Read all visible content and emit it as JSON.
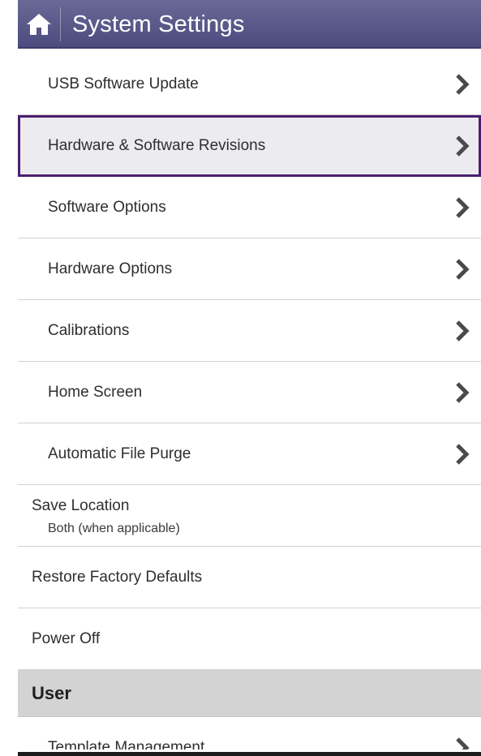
{
  "header": {
    "title": "System Settings",
    "home_icon": "home-icon",
    "bar_color": "#55558a"
  },
  "menu": {
    "items": [
      {
        "label": "USB Software Update",
        "chevron": "chevron-right-icon"
      },
      {
        "label": "Hardware & Software Revisions",
        "chevron": "chevron-right-icon",
        "selected": true
      },
      {
        "label": "Software Options",
        "chevron": "chevron-right-icon"
      },
      {
        "label": "Hardware Options",
        "chevron": "chevron-right-icon"
      },
      {
        "label": "Calibrations",
        "chevron": "chevron-right-icon"
      },
      {
        "label": "Home Screen",
        "chevron": "chevron-right-icon"
      },
      {
        "label": "Automatic File Purge",
        "chevron": "chevron-right-icon"
      }
    ],
    "save_location": {
      "label": "Save Location",
      "value": "Both (when applicable)"
    },
    "restore_defaults": {
      "label": "Restore Factory Defaults"
    },
    "power_off": {
      "label": "Power Off"
    }
  },
  "user_section": {
    "header": "User",
    "items": [
      {
        "label": "Template Management",
        "chevron": "chevron-right-icon"
      }
    ]
  },
  "colors": {
    "selected_outline": "#4b1f6e",
    "selected_background": "#ecebf0",
    "section_background": "#d3d3d4"
  }
}
